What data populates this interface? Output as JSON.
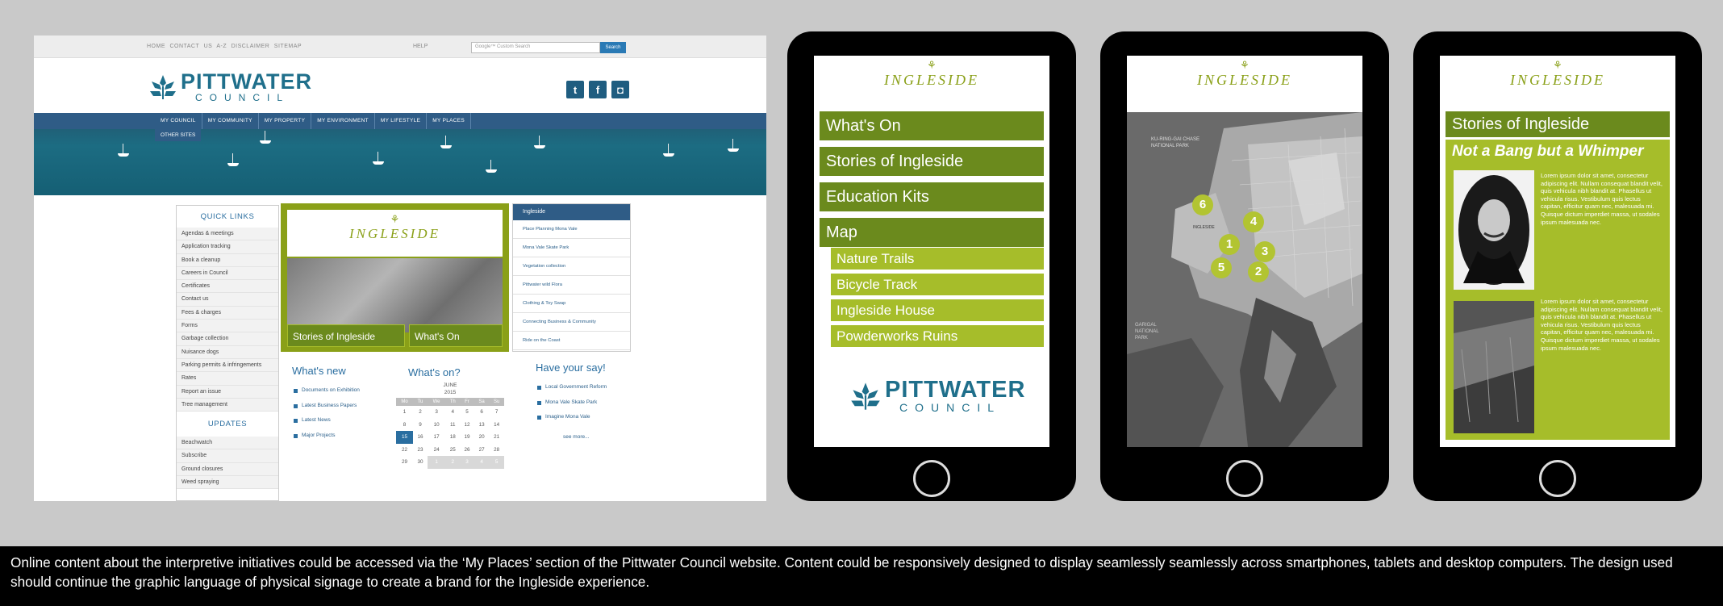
{
  "desktop": {
    "top_links": "HOME  CONTACT US  A-Z  DISCLAIMER  SITEMAP",
    "help_link": "HELP",
    "search_placeholder": "Google™ Custom Search",
    "search_button": "Search",
    "logo_big": "PITTWATER",
    "logo_small": "COUNCIL",
    "social_icons": [
      "twitter-icon",
      "facebook-icon",
      "instagram-icon"
    ],
    "nav": [
      "MY COUNCIL",
      "MY COMMUNITY",
      "MY PROPERTY",
      "MY ENVIRONMENT",
      "MY LIFESTYLE",
      "MY PLACES"
    ],
    "nav_second_row": "OTHER SITES",
    "quick_links_title": "QUICK LINKS",
    "quick_links": [
      "Agendas & meetings",
      "Application tracking",
      "Book a cleanup",
      "Careers in Council",
      "Certificates",
      "Contact us",
      "Fees & charges",
      "Forms",
      "Garbage collection",
      "Nuisance dogs",
      "Parking permits & infringements",
      "Rates",
      "Report an issue",
      "Tree management"
    ],
    "updates_title": "UPDATES",
    "updates": [
      "Beachwatch",
      "Subscribe",
      "Ground closures",
      "Weed spraying"
    ],
    "feature_logo": "INGLESIDE",
    "feature_buttons": [
      "Stories of Ingleside",
      "What's On"
    ],
    "side_panel_title": "Ingleside",
    "side_panel_items": [
      "Place Planning Mona Vale",
      "Mona Vale Skate Park",
      "Vegetation collection",
      "Pittwater wild Flora",
      "Clothing & Toy Swap",
      "Connecting Business & Community",
      "Ride on the Coast"
    ],
    "whats_new_title": "What's new",
    "whats_new": [
      "Documents on Exhibition",
      "Latest Business Papers",
      "Latest News",
      "Major Projects"
    ],
    "whats_on_title": "What's on?",
    "calendar": {
      "month": "JUNE",
      "year": "2015",
      "days": [
        "Mo",
        "Tu",
        "We",
        "Th",
        "Fr",
        "Sa",
        "Su"
      ],
      "weeks": [
        [
          "1",
          "2",
          "3",
          "4",
          "5",
          "6",
          "7"
        ],
        [
          "8",
          "9",
          "10",
          "11",
          "12",
          "13",
          "14"
        ],
        [
          "15",
          "16",
          "17",
          "18",
          "19",
          "20",
          "21"
        ],
        [
          "22",
          "23",
          "24",
          "25",
          "26",
          "27",
          "28"
        ],
        [
          "29",
          "30",
          "1",
          "2",
          "3",
          "4",
          "5"
        ]
      ],
      "selected": "15"
    },
    "have_say_title": "Have your say!",
    "have_say": [
      "Local Government Reform",
      "Mona Vale Skate Park",
      "Imagine Mona Vale"
    ],
    "see_more": "see more..."
  },
  "tablet1": {
    "logo": "INGLESIDE",
    "menu": [
      "What's On",
      "Stories of Ingleside",
      "Education Kits",
      "Map"
    ],
    "submenu": [
      "Nature Trails",
      "Bicycle Track",
      "Ingleside House",
      "Powderworks Ruins"
    ],
    "footer_logo_big": "PITTWATER",
    "footer_logo_small": "COUNCIL"
  },
  "tablet2": {
    "logo": "INGLESIDE",
    "map_labels": [
      "KU-RING-GAI CHASE NATIONAL PARK",
      "INGLESIDE",
      "GARIGAL NATIONAL PARK"
    ],
    "pins": [
      "6",
      "4",
      "1",
      "3",
      "5",
      "2"
    ]
  },
  "tablet3": {
    "logo": "INGLESIDE",
    "header": "Stories of Ingleside",
    "story_title": "Not a Bang but a Whimper",
    "para1": "Lorem ipsum dolor sit amet, consectetur adipiscing elit. Nullam consequat blandit velit, quis vehicula nibh blandit at. Phasellus ut vehicula risus. Vestibulum quis lectus capitan, efficitur quam nec, malesuada mi. Quisque dictum imperdiet massa, ut sodales ipsum malesuada nec.",
    "para2": "Lorem ipsum dolor sit amet, consectetur adipiscing elit. Nullam consequat blandit velit, quis vehicula nibh blandit at. Phasellus ut vehicula risus. Vestibulum quis lectus capitan, efficitur quam nec, malesuada mi. Quisque dictum imperdiet massa, ut sodales ipsum malesuada nec."
  },
  "caption": "Online content about the interpretive initiatives could be accessed via the ‘My Places’ section of the Pittwater Council website. Content could be responsively designed to display seamlessly seamlessly across smartphones, tablets and desktop computers. The design used should continue the graphic language of physical signage to create a brand for the Ingleside experience.",
  "colors": {
    "olive": "#6b8a1d",
    "lime": "#a6bd2a",
    "council_blue": "#2f5c86",
    "background": "#c9c9c9"
  }
}
